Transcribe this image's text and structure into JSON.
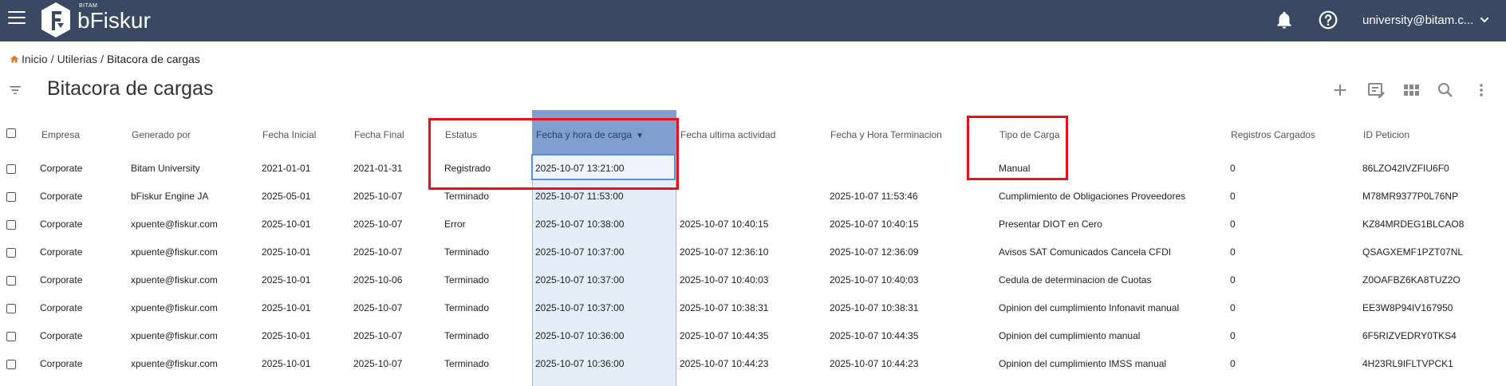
{
  "header": {
    "logo_small": "BITAM",
    "logo_name": "bFiskur",
    "user": "university@bitam.c..."
  },
  "breadcrumb": {
    "home": "Inicio",
    "section": "Utilerias",
    "current": "Bitacora de cargas"
  },
  "page": {
    "title": "Bitacora de cargas"
  },
  "table": {
    "columns": [
      "Empresa",
      "Generado por",
      "Fecha Inicial",
      "Fecha Final",
      "Estatus",
      "Fecha y hora de carga",
      "Fecha ultima actividad",
      "Fecha y Hora Terminacion",
      "Tipo de Carga",
      "Registros Cargados",
      "ID Peticion"
    ],
    "sorted_column": "Fecha y hora de carga",
    "sort_direction": "descending",
    "rows": [
      [
        "Corporate",
        "Bitam University",
        "2021-01-01",
        "2021-01-31",
        "Registrado",
        "2025-10-07 13:21:00",
        "",
        "",
        "Manual",
        "0",
        "86LZO42IVZFIU6F0"
      ],
      [
        "Corporate",
        "bFiskur Engine JA",
        "2025-05-01",
        "2025-10-07",
        "Terminado",
        "2025-10-07 11:53:00",
        "",
        "2025-10-07 11:53:46",
        "Cumplimiento de Obligaciones Proveedores",
        "0",
        "M78MR9377P0L76NP"
      ],
      [
        "Corporate",
        "xpuente@fiskur.com",
        "2025-10-01",
        "2025-10-07",
        "Error",
        "2025-10-07 10:38:00",
        "2025-10-07 10:40:15",
        "2025-10-07 10:40:15",
        "Presentar DIOT en Cero",
        "0",
        "KZ84MRDEG1BLCAO8"
      ],
      [
        "Corporate",
        "xpuente@fiskur.com",
        "2025-10-01",
        "2025-10-07",
        "Terminado",
        "2025-10-07 10:37:00",
        "2025-10-07 12:36:10",
        "2025-10-07 12:36:09",
        "Avisos SAT Comunicados Cancela CFDI",
        "0",
        "QSAGXEMF1PZT07NL"
      ],
      [
        "Corporate",
        "xpuente@fiskur.com",
        "2025-10-01",
        "2025-10-06",
        "Terminado",
        "2025-10-07 10:37:00",
        "2025-10-07 10:40:03",
        "2025-10-07 10:40:03",
        "Cedula de determinacion de Cuotas",
        "0",
        "Z0OAFBZ6KA8TUZ2O"
      ],
      [
        "Corporate",
        "xpuente@fiskur.com",
        "2025-10-01",
        "2025-10-07",
        "Terminado",
        "2025-10-07 10:37:00",
        "2025-10-07 10:38:31",
        "2025-10-07 10:38:31",
        "Opinion del cumplimiento Infonavit manual",
        "0",
        "EE3W8P94IV167950"
      ],
      [
        "Corporate",
        "xpuente@fiskur.com",
        "2025-10-01",
        "2025-10-07",
        "Terminado",
        "2025-10-07 10:36:00",
        "2025-10-07 10:44:35",
        "2025-10-07 10:44:35",
        "Opinion del cumplimiento manual",
        "0",
        "6F5RIZVEDRY0TKS4"
      ],
      [
        "Corporate",
        "xpuente@fiskur.com",
        "2025-10-01",
        "2025-10-07",
        "Terminado",
        "2025-10-07 10:36:00",
        "2025-10-07 10:44:23",
        "2025-10-07 10:44:23",
        "Opinion del cumplimiento IMSS manual",
        "0",
        "4H23RL9IFLTVPCK1"
      ]
    ]
  },
  "icons": [
    "menu-icon",
    "bell-icon",
    "help-icon",
    "chevron-down-icon",
    "home-icon",
    "filter-icon",
    "add-icon",
    "edit-columns-icon",
    "grid-view-icon",
    "search-icon",
    "more-vert-icon"
  ],
  "colors": {
    "header_bg": "#3b4863",
    "sort_column_bg": "#e3eef9",
    "sort_header_bg": "#7f9fcf",
    "highlight": "#e8101a",
    "home_icon": "#e8741a"
  }
}
